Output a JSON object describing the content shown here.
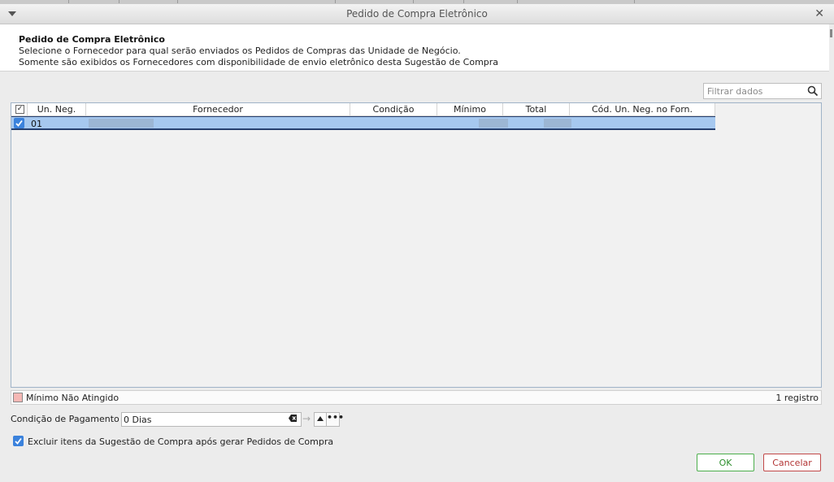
{
  "window": {
    "title": "Pedido de Compra Eletrônico"
  },
  "header": {
    "title": "Pedido de Compra Eletrônico",
    "line1": "Selecione o Fornecedor para qual serão enviados os Pedidos de Compras das Unidade de Negócio.",
    "line2": "Somente são exibidos os Fornecedores com disponibilidade de envio eletrônico desta Sugestão de Compra"
  },
  "search": {
    "placeholder": "Filtrar dados"
  },
  "grid": {
    "columns": [
      "Un. Neg.",
      "Fornecedor",
      "Condição",
      "Mínimo",
      "Total",
      "Cód. Un. Neg. no Forn."
    ],
    "rows": [
      {
        "selected": true,
        "un_neg": "01"
      }
    ]
  },
  "legend": {
    "label": "Mínimo Não Atingido",
    "color": "#f5b8b5",
    "count": "1 registro"
  },
  "payment": {
    "label": "Condição de Pagamento",
    "value": "0 Dias"
  },
  "exclude": {
    "checked": true,
    "label": "Excluir itens da Sugestão de Compra após gerar Pedidos de Compra"
  },
  "buttons": {
    "ok": "OK",
    "cancel": "Cancelar"
  }
}
